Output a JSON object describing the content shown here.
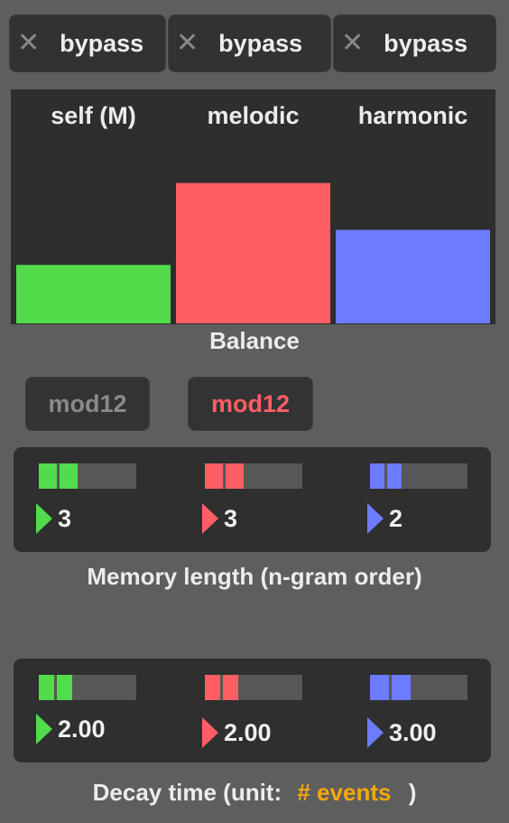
{
  "bypass_buttons": [
    {
      "label": "bypass",
      "icon": "close-icon"
    },
    {
      "label": "bypass",
      "icon": "close-icon"
    },
    {
      "label": "bypass",
      "icon": "close-icon"
    }
  ],
  "colors": {
    "self": "#52dc4c",
    "melodic": "#ff5e65",
    "harmonic": "#6d7bff",
    "unit": "#f5a70f",
    "mod_inactive": "#8a8a8a"
  },
  "chart_data": {
    "type": "bar",
    "categories": [
      "self (M)",
      "melodic",
      "harmonic"
    ],
    "values": [
      0.25,
      0.6,
      0.4
    ],
    "ylim": [
      0,
      1
    ],
    "xlabel": "Balance",
    "grid": false,
    "legend": "none"
  },
  "balance_caption": "Balance",
  "mod_buttons": [
    {
      "label": "mod12",
      "active": false
    },
    {
      "label": "mod12",
      "active": true
    }
  ],
  "memory": {
    "caption": "Memory length (n-gram order)",
    "channels": [
      {
        "value": "3",
        "fill": 0.4
      },
      {
        "value": "3",
        "fill": 0.4
      },
      {
        "value": "2",
        "fill": 0.32
      }
    ]
  },
  "decay": {
    "caption_prefix": "Decay time (unit:",
    "unit": "# events",
    "caption_suffix": ")",
    "channels": [
      {
        "value": "2.00",
        "fill": 0.34
      },
      {
        "value": "2.00",
        "fill": 0.34
      },
      {
        "value": "3.00",
        "fill": 0.42
      }
    ]
  }
}
